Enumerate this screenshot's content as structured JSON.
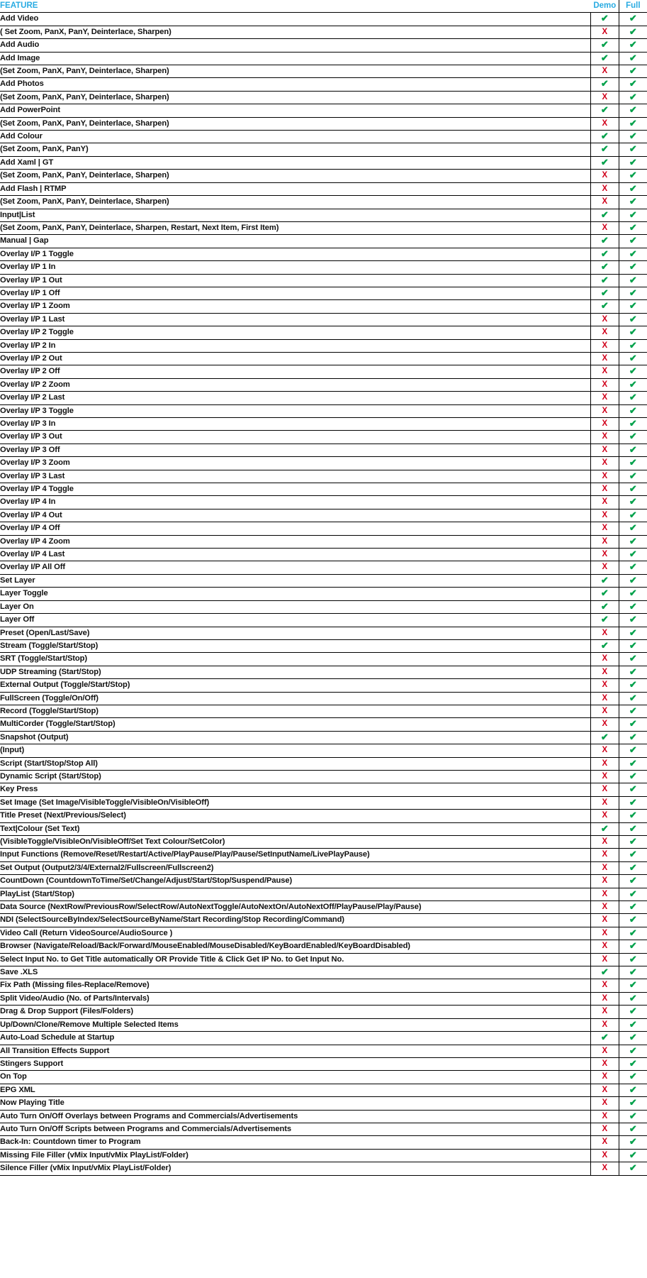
{
  "header": {
    "feature_label": "FEATURE",
    "demo_label": "Demo",
    "full_label": "Full",
    "header_color": "#29ABE2"
  },
  "legend": {
    "check_symbol": "✔",
    "cross_symbol": "X",
    "check_color": "#00A14B",
    "cross_color": "#D0021B"
  },
  "columns": [
    "FEATURE",
    "Demo",
    "Full"
  ],
  "rows": [
    {
      "feature": "Add Video",
      "indent": false,
      "demo": "check",
      "full": "check"
    },
    {
      "feature": "( Set Zoom, PanX, PanY, Deinterlace, Sharpen)",
      "indent": true,
      "demo": "cross",
      "full": "check"
    },
    {
      "feature": "Add Audio",
      "indent": false,
      "demo": "check",
      "full": "check"
    },
    {
      "feature": "Add Image",
      "indent": false,
      "demo": "check",
      "full": "check"
    },
    {
      "feature": "(Set Zoom, PanX, PanY, Deinterlace, Sharpen)",
      "indent": true,
      "demo": "cross",
      "full": "check"
    },
    {
      "feature": "Add Photos",
      "indent": false,
      "demo": "check",
      "full": "check"
    },
    {
      "feature": "(Set Zoom, PanX, PanY, Deinterlace, Sharpen)",
      "indent": true,
      "demo": "cross",
      "full": "check"
    },
    {
      "feature": "Add PowerPoint",
      "indent": false,
      "demo": "check",
      "full": "check"
    },
    {
      "feature": "(Set Zoom, PanX, PanY, Deinterlace, Sharpen)",
      "indent": true,
      "demo": "cross",
      "full": "check"
    },
    {
      "feature": "Add Colour",
      "indent": false,
      "demo": "check",
      "full": "check"
    },
    {
      "feature": "(Set Zoom, PanX, PanY)",
      "indent": true,
      "demo": "check",
      "full": "check"
    },
    {
      "feature": "Add Xaml | GT",
      "indent": false,
      "demo": "check",
      "full": "check"
    },
    {
      "feature": "(Set Zoom, PanX, PanY, Deinterlace, Sharpen)",
      "indent": true,
      "demo": "cross",
      "full": "check"
    },
    {
      "feature": "Add Flash | RTMP",
      "indent": false,
      "demo": "cross",
      "full": "check"
    },
    {
      "feature": "(Set Zoom, PanX, PanY, Deinterlace, Sharpen)",
      "indent": true,
      "demo": "cross",
      "full": "check"
    },
    {
      "feature": "Input|List",
      "indent": false,
      "demo": "check",
      "full": "check"
    },
    {
      "feature": "(Set Zoom, PanX, PanY, Deinterlace, Sharpen, Restart, Next Item, First Item)",
      "indent": true,
      "demo": "cross",
      "full": "check"
    },
    {
      "feature": "Manual | Gap",
      "indent": false,
      "demo": "check",
      "full": "check"
    },
    {
      "feature": "Overlay I/P 1 Toggle",
      "indent": false,
      "demo": "check",
      "full": "check"
    },
    {
      "feature": "Overlay I/P 1 In",
      "indent": false,
      "demo": "check",
      "full": "check"
    },
    {
      "feature": "Overlay I/P 1 Out",
      "indent": false,
      "demo": "check",
      "full": "check"
    },
    {
      "feature": "Overlay I/P 1 Off",
      "indent": false,
      "demo": "check",
      "full": "check"
    },
    {
      "feature": "Overlay I/P 1 Zoom",
      "indent": false,
      "demo": "check",
      "full": "check"
    },
    {
      "feature": "Overlay I/P 1 Last",
      "indent": false,
      "demo": "cross",
      "full": "check"
    },
    {
      "feature": "Overlay I/P 2 Toggle",
      "indent": false,
      "demo": "cross",
      "full": "check"
    },
    {
      "feature": "Overlay I/P 2 In",
      "indent": false,
      "demo": "cross",
      "full": "check"
    },
    {
      "feature": "Overlay I/P 2 Out",
      "indent": false,
      "demo": "cross",
      "full": "check"
    },
    {
      "feature": "Overlay I/P 2 Off",
      "indent": false,
      "demo": "cross",
      "full": "check"
    },
    {
      "feature": "Overlay I/P 2 Zoom",
      "indent": false,
      "demo": "cross",
      "full": "check"
    },
    {
      "feature": "Overlay I/P 2 Last",
      "indent": false,
      "demo": "cross",
      "full": "check"
    },
    {
      "feature": "Overlay I/P 3 Toggle",
      "indent": false,
      "demo": "cross",
      "full": "check"
    },
    {
      "feature": "Overlay I/P 3 In",
      "indent": false,
      "demo": "cross",
      "full": "check"
    },
    {
      "feature": "Overlay I/P 3 Out",
      "indent": false,
      "demo": "cross",
      "full": "check"
    },
    {
      "feature": "Overlay I/P 3 Off",
      "indent": false,
      "demo": "cross",
      "full": "check"
    },
    {
      "feature": "Overlay I/P 3 Zoom",
      "indent": false,
      "demo": "cross",
      "full": "check"
    },
    {
      "feature": "Overlay I/P 3 Last",
      "indent": false,
      "demo": "cross",
      "full": "check"
    },
    {
      "feature": "Overlay I/P 4 Toggle",
      "indent": false,
      "demo": "cross",
      "full": "check"
    },
    {
      "feature": "Overlay I/P 4 In",
      "indent": false,
      "demo": "cross",
      "full": "check"
    },
    {
      "feature": "Overlay I/P 4 Out",
      "indent": false,
      "demo": "cross",
      "full": "check"
    },
    {
      "feature": "Overlay I/P 4 Off",
      "indent": false,
      "demo": "cross",
      "full": "check"
    },
    {
      "feature": "Overlay I/P 4 Zoom",
      "indent": false,
      "demo": "cross",
      "full": "check"
    },
    {
      "feature": "Overlay I/P 4 Last",
      "indent": false,
      "demo": "cross",
      "full": "check"
    },
    {
      "feature": "Overlay I/P All Off",
      "indent": false,
      "demo": "cross",
      "full": "check"
    },
    {
      "feature": "Set Layer",
      "indent": false,
      "demo": "check",
      "full": "check"
    },
    {
      "feature": "Layer Toggle",
      "indent": false,
      "demo": "check",
      "full": "check"
    },
    {
      "feature": "Layer On",
      "indent": false,
      "demo": "check",
      "full": "check"
    },
    {
      "feature": "Layer Off",
      "indent": false,
      "demo": "check",
      "full": "check"
    },
    {
      "feature": "Preset (Open/Last/Save)",
      "indent": false,
      "demo": "cross",
      "full": "check"
    },
    {
      "feature": "Stream (Toggle/Start/Stop)",
      "indent": false,
      "demo": "check",
      "full": "check"
    },
    {
      "feature": "SRT (Toggle/Start/Stop)",
      "indent": false,
      "demo": "cross",
      "full": "check"
    },
    {
      "feature": "UDP Streaming (Start/Stop)",
      "indent": false,
      "demo": "cross",
      "full": "check"
    },
    {
      "feature": "External Output (Toggle/Start/Stop)",
      "indent": false,
      "demo": "cross",
      "full": "check"
    },
    {
      "feature": "FullScreen (Toggle/On/Off)",
      "indent": false,
      "demo": "cross",
      "full": "check"
    },
    {
      "feature": "Record (Toggle/Start/Stop)",
      "indent": false,
      "demo": "cross",
      "full": "check"
    },
    {
      "feature": "MultiCorder (Toggle/Start/Stop)",
      "indent": false,
      "demo": "cross",
      "full": "check"
    },
    {
      "feature": "Snapshot (Output)",
      "indent": false,
      "demo": "check",
      "full": "check"
    },
    {
      "feature": "(Input)",
      "indent": true,
      "demo": "cross",
      "full": "check"
    },
    {
      "feature": "Script (Start/Stop/Stop All)",
      "indent": false,
      "demo": "cross",
      "full": "check"
    },
    {
      "feature": "Dynamic Script (Start/Stop)",
      "indent": false,
      "demo": "cross",
      "full": "check"
    },
    {
      "feature": "Key Press",
      "indent": false,
      "demo": "cross",
      "full": "check"
    },
    {
      "feature": "Set Image (Set Image/VisibleToggle/VisibleOn/VisibleOff)",
      "indent": false,
      "demo": "cross",
      "full": "check"
    },
    {
      "feature": "Title Preset (Next/Previous/Select)",
      "indent": false,
      "demo": "cross",
      "full": "check"
    },
    {
      "feature": "Text|Colour (Set Text)",
      "indent": false,
      "demo": "check",
      "full": "check"
    },
    {
      "feature": "(VisibleToggle/VisibleOn/VisibleOff/Set Text Colour/SetColor)",
      "indent": true,
      "demo": "cross",
      "full": "check"
    },
    {
      "feature": "Input Functions (Remove/Reset/Restart/Active/PlayPause/Play/Pause/SetInputName/LivePlayPause)",
      "indent": false,
      "demo": "cross",
      "full": "check"
    },
    {
      "feature": "Set Output (Output2/3/4/External2/Fullscreen/Fullscreen2)",
      "indent": false,
      "demo": "cross",
      "full": "check"
    },
    {
      "feature": "CountDown (CountdownToTime/Set/Change/Adjust/Start/Stop/Suspend/Pause)",
      "indent": false,
      "demo": "cross",
      "full": "check"
    },
    {
      "feature": "PlayList (Start/Stop)",
      "indent": false,
      "demo": "cross",
      "full": "check"
    },
    {
      "feature": "Data Source (NextRow/PreviousRow/SelectRow/AutoNextToggle/AutoNextOn/AutoNextOff/PlayPause/Play/Pause)",
      "indent": false,
      "demo": "cross",
      "full": "check"
    },
    {
      "feature": "NDI (SelectSourceByIndex/SelectSourceByName/Start Recording/Stop Recording/Command)",
      "indent": false,
      "demo": "cross",
      "full": "check"
    },
    {
      "feature": "Video Call (Return VideoSource/AudioSource )",
      "indent": false,
      "demo": "cross",
      "full": "check"
    },
    {
      "feature": "Browser (Navigate/Reload/Back/Forward/MouseEnabled/MouseDisabled/KeyBoardEnabled/KeyBoardDisabled)",
      "indent": false,
      "demo": "cross",
      "full": "check"
    },
    {
      "feature": "Select Input No. to Get Title automatically OR Provide Title & Click Get IP No. to Get Input No.",
      "indent": false,
      "demo": "cross",
      "full": "check"
    },
    {
      "feature": "Save .XLS",
      "indent": false,
      "demo": "check",
      "full": "check"
    },
    {
      "feature": "Fix Path (Missing files-Replace/Remove)",
      "indent": false,
      "demo": "cross",
      "full": "check"
    },
    {
      "feature": "Split Video/Audio (No. of Parts/Intervals)",
      "indent": false,
      "demo": "cross",
      "full": "check"
    },
    {
      "feature": "Drag & Drop Support (Files/Folders)",
      "indent": false,
      "demo": "cross",
      "full": "check"
    },
    {
      "feature": "Up/Down/Clone/Remove Multiple Selected Items",
      "indent": false,
      "demo": "cross",
      "full": "check"
    },
    {
      "feature": "Auto-Load Schedule at Startup",
      "indent": false,
      "demo": "check",
      "full": "check"
    },
    {
      "feature": "All Transition Effects Support",
      "indent": false,
      "demo": "cross",
      "full": "check"
    },
    {
      "feature": "Stingers Support",
      "indent": false,
      "demo": "cross",
      "full": "check"
    },
    {
      "feature": "On Top",
      "indent": false,
      "demo": "cross",
      "full": "check"
    },
    {
      "feature": "EPG XML",
      "indent": false,
      "demo": "cross",
      "full": "check"
    },
    {
      "feature": "Now Playing Title",
      "indent": false,
      "demo": "cross",
      "full": "check"
    },
    {
      "feature": "Auto Turn On/Off Overlays between Programs and Commercials/Advertisements",
      "indent": false,
      "demo": "cross",
      "full": "check"
    },
    {
      "feature": "Auto Turn On/Off Scripts between Programs and Commercials/Advertisements",
      "indent": false,
      "demo": "cross",
      "full": "check"
    },
    {
      "feature": "Back-In: Countdown timer to Program",
      "indent": false,
      "demo": "cross",
      "full": "check"
    },
    {
      "feature": "Missing File Filler (vMix Input/vMix PlayList/Folder)",
      "indent": false,
      "demo": "cross",
      "full": "check"
    },
    {
      "feature": "Silence Filler (vMix Input/vMix PlayList/Folder)",
      "indent": false,
      "demo": "cross",
      "full": "check"
    }
  ]
}
